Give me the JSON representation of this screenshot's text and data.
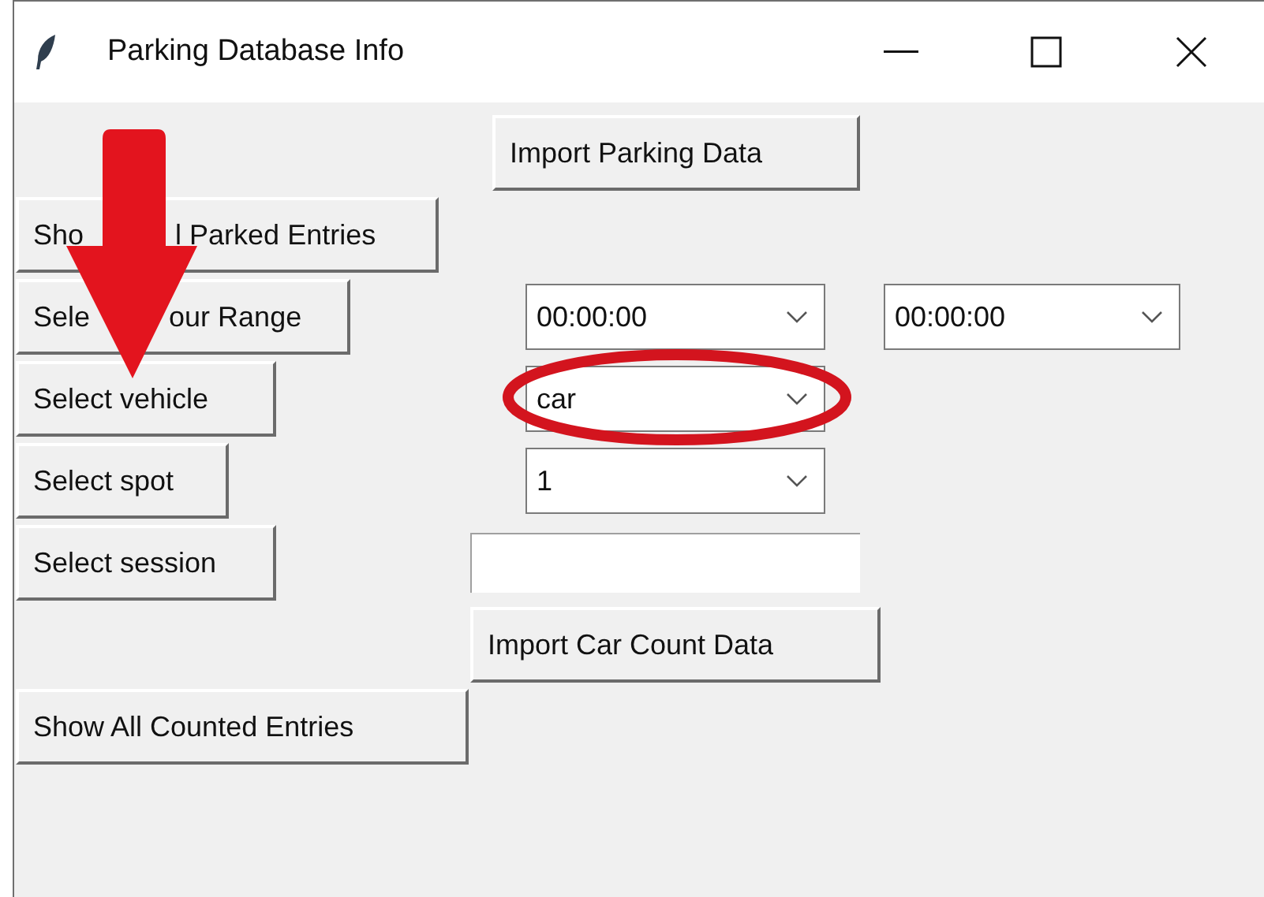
{
  "window": {
    "title": "Parking Database Info"
  },
  "rows": [
    {
      "items": [
        {
          "kind": "button",
          "label": "Import Parking Data"
        }
      ]
    },
    {
      "items": [
        {
          "kind": "button",
          "label_parts": [
            "Sho",
            "l Parked Entries"
          ]
        }
      ]
    },
    {
      "items": [
        {
          "kind": "button",
          "label_parts": [
            "Sele",
            "our Range"
          ]
        },
        {
          "kind": "combobox",
          "value": "00:00:00"
        },
        {
          "kind": "combobox",
          "value": "00:00:00"
        }
      ]
    },
    {
      "items": [
        {
          "kind": "button",
          "label": "Select vehicle"
        },
        {
          "kind": "combobox",
          "value": "car"
        }
      ]
    },
    {
      "items": [
        {
          "kind": "button",
          "label": "Select spot"
        },
        {
          "kind": "combobox",
          "value": "1"
        }
      ]
    },
    {
      "items": [
        {
          "kind": "button",
          "label": "Select session"
        },
        {
          "kind": "entry"
        }
      ]
    },
    {
      "items": [
        {
          "kind": "button",
          "label": "Import Car Count Data"
        }
      ]
    },
    {
      "items": [
        {
          "kind": "button",
          "label": "Show All Counted Entries"
        }
      ]
    }
  ],
  "annotations": [
    {
      "kind": "arrow"
    },
    {
      "kind": "ellipse"
    }
  ]
}
